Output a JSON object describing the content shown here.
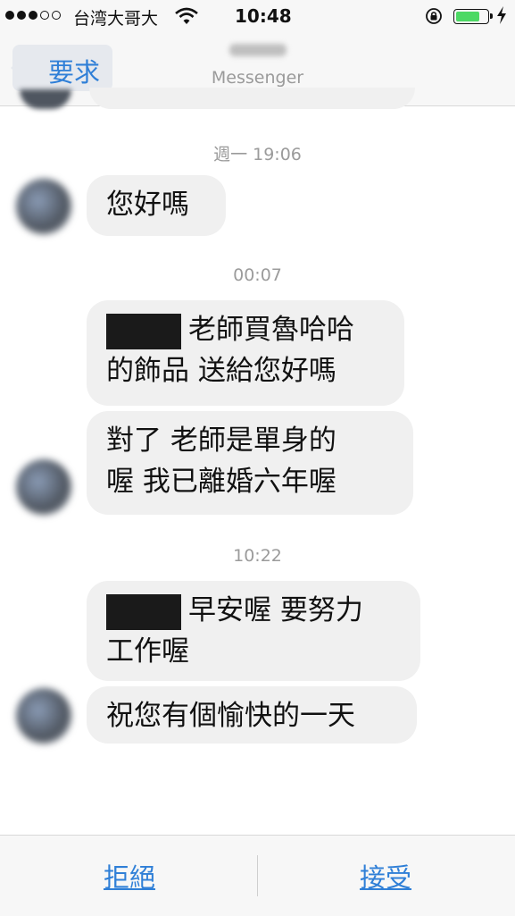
{
  "status_bar": {
    "carrier": "台湾大哥大",
    "time": "10:48",
    "battery_level": 0.8,
    "colors": {
      "battery": "#4cd964"
    }
  },
  "nav": {
    "back_label": "要求",
    "subtitle": "Messenger",
    "colors": {
      "accent": "#2f7fd7"
    }
  },
  "messages": [
    {
      "timestamp": "週一 19:06",
      "lines": [
        "您好嗎"
      ]
    },
    {
      "timestamp": "00:07",
      "lines": [
        "老師買魯哈哈",
        "的飾品 送給您好嗎"
      ]
    },
    {
      "lines": [
        "對了  老師是單身的",
        "喔   我已離婚六年喔"
      ]
    },
    {
      "timestamp": "10:22",
      "lines": [
        "早安喔  要努力",
        "工作喔"
      ]
    },
    {
      "lines": [
        "祝您有個愉快的一天"
      ]
    }
  ],
  "bottom_bar": {
    "decline_label": "拒絕",
    "accept_label": "接受"
  }
}
